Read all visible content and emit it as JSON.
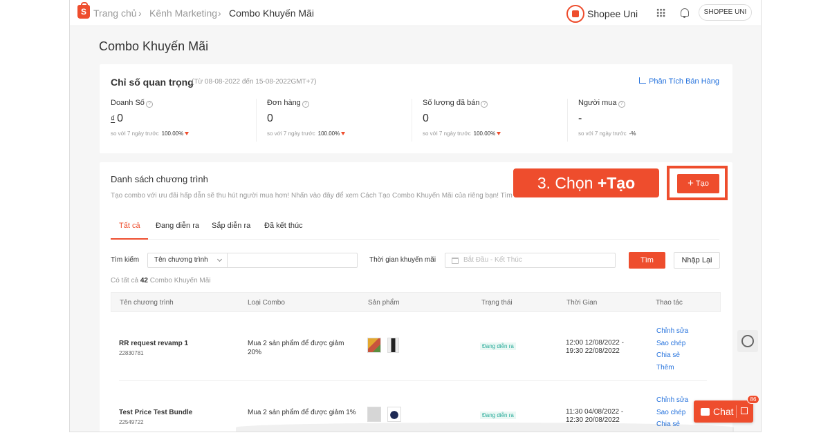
{
  "nav": {
    "breadcrumbs": [
      "Trang chủ",
      "Kênh Marketing",
      "Combo Khuyến Mãi"
    ],
    "logo_letter": "S",
    "uni_label": "Shopee Uni",
    "user_label": "SHOPEE UNI"
  },
  "page": {
    "title": "Combo Khuyến Mãi"
  },
  "stats": {
    "title": "Chỉ số quan trọng",
    "range": "(Từ 08-08-2022 đến 15-08-2022GMT+7)",
    "analysis_link": "Phân Tích Bán Hàng",
    "compare_label": "so với 7 ngày trước",
    "metrics": [
      {
        "label": "Doanh Số",
        "currency": "₫",
        "value": "0",
        "change": "100.00%"
      },
      {
        "label": "Đơn hàng",
        "value": "0",
        "change": "100.00%"
      },
      {
        "label": "Số lượng đã bán",
        "value": "0",
        "change": "100.00%"
      },
      {
        "label": "Người mua",
        "value": "-",
        "change": "-%"
      }
    ]
  },
  "list": {
    "title": "Danh sách chương trình",
    "description": "Tạo combo với ưu đãi hấp dẫn sẽ thu hút người mua hơn! Nhấn vào đây để xem Cách Tạo Combo Khuyến Mãi của riêng bạn! Tìm hiểu thêm",
    "create_label": "Tạo",
    "tabs": [
      "Tất cả",
      "Đang diễn ra",
      "Sắp diễn ra",
      "Đã kết thúc"
    ],
    "search_label": "Tìm kiếm",
    "search_select": "Tên chương trình",
    "time_label": "Thời gian khuyến mãi",
    "date_placeholder": "Bắt Đầu - Kết Thúc",
    "find_label": "Tìm",
    "reset_label": "Nhập Lại",
    "total_prefix": "Có tất cả",
    "total_count": "42",
    "total_suffix": "Combo Khuyến Mãi",
    "columns": [
      "Tên chương trình",
      "Loại Combo",
      "Sản phẩm",
      "Trạng thái",
      "Thời Gian",
      "Thao tác"
    ],
    "rows": [
      {
        "name": "RR request revamp 1",
        "id": "22830781",
        "type": "Mua 2 sản phẩm để được giảm 20%",
        "status": "Đang diễn ra",
        "time_start": "12:00 12/08/2022 -",
        "time_end": "19:30 22/08/2022",
        "actions": [
          "Chỉnh sửa",
          "Sao chép",
          "Chia sẻ",
          "Thêm"
        ]
      },
      {
        "name": "Test Price Test Bundle",
        "id": "22549722",
        "type": "Mua 2 sản phẩm để được giảm 1%",
        "status": "Đang diễn ra",
        "time_start": "11:30 04/08/2022 -",
        "time_end": "12:30 20/08/2022",
        "actions": [
          "Chỉnh sửa",
          "Sao chép",
          "Chia sẻ"
        ]
      }
    ]
  },
  "overlay": {
    "callout_prefix": "3. Chọn ",
    "callout_bold": "+Tạo"
  },
  "chat": {
    "label": "Chat",
    "count": "86"
  },
  "colors": {
    "brand": "#ee4d2d",
    "link": "#2673dd",
    "success": "#26aa99"
  }
}
